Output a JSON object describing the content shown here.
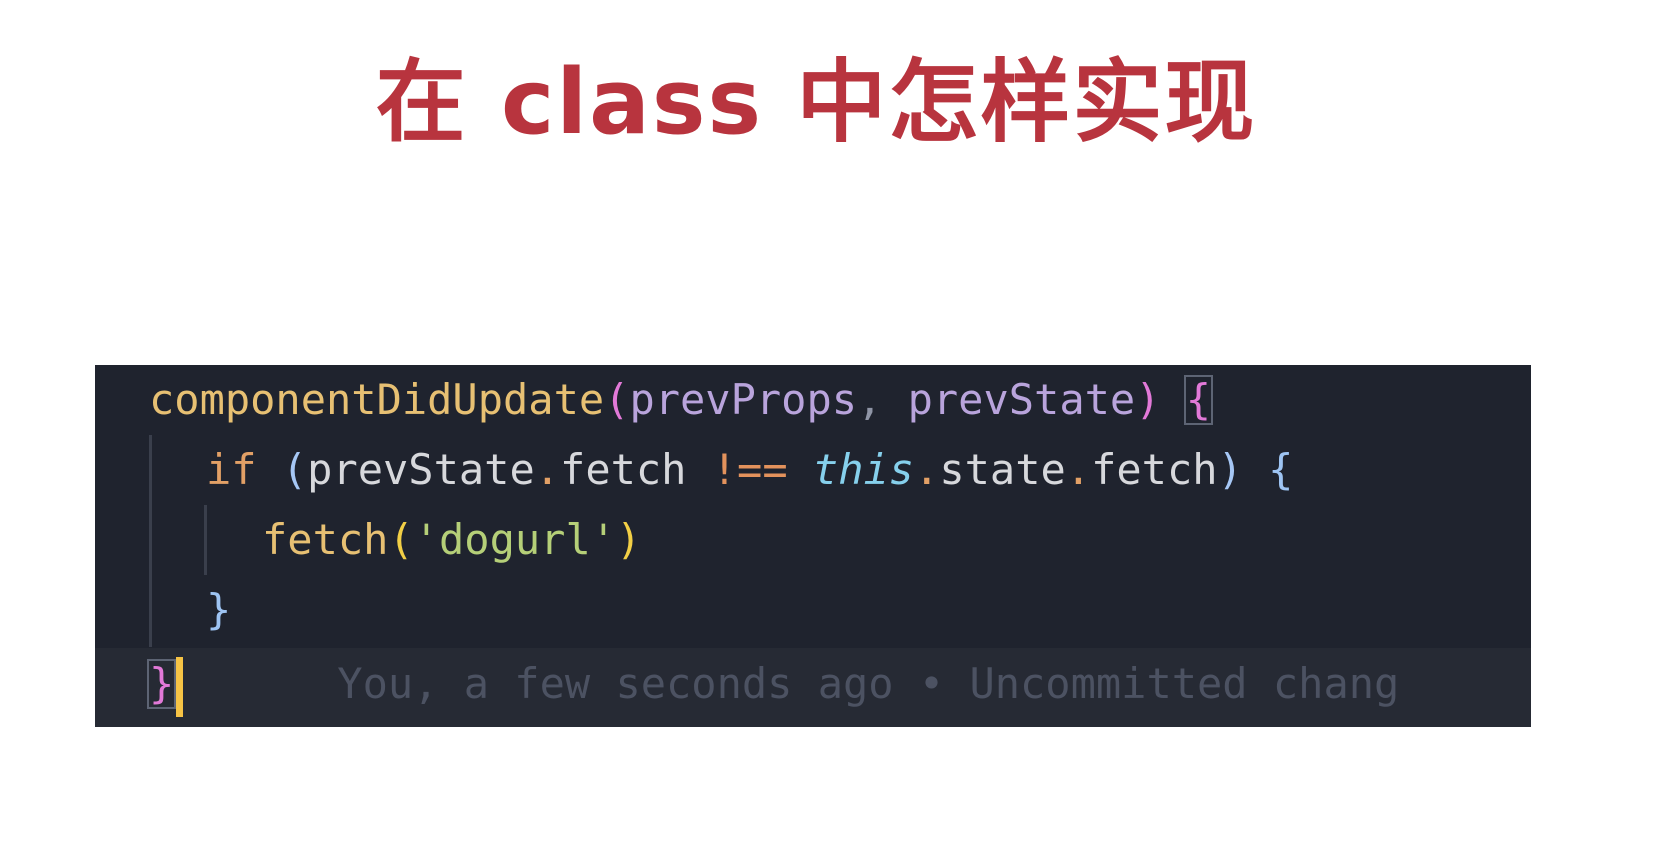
{
  "slide": {
    "title": "在 class 中怎样实现"
  },
  "code": {
    "line1": {
      "method": "componentDidUpdate",
      "open_paren": "(",
      "param1": "prevProps",
      "comma": ", ",
      "param2": "prevState",
      "close_paren": ") ",
      "open_brace": "{"
    },
    "line2": {
      "keyword": "if ",
      "open_paren": "(",
      "object": "prevState",
      "dot1": ".",
      "prop1": "fetch ",
      "operator": "!==",
      "space": " ",
      "this_kw": "this",
      "dot2": ".",
      "prop2": "state",
      "dot3": ".",
      "prop3": "fetch",
      "close_paren": ") ",
      "open_brace": "{"
    },
    "line3": {
      "call": "fetch",
      "open_paren": "(",
      "string": "'dogurl'",
      "close_paren": ")"
    },
    "line4": {
      "close_brace": "}"
    },
    "line5": {
      "close_brace": "}",
      "blame": "You, a few seconds ago • Uncommitted chang"
    }
  },
  "colors": {
    "title": "#b8343e",
    "editor_background": "#1f232e",
    "current_line": "#262a34",
    "cursor": "#f6c345"
  }
}
